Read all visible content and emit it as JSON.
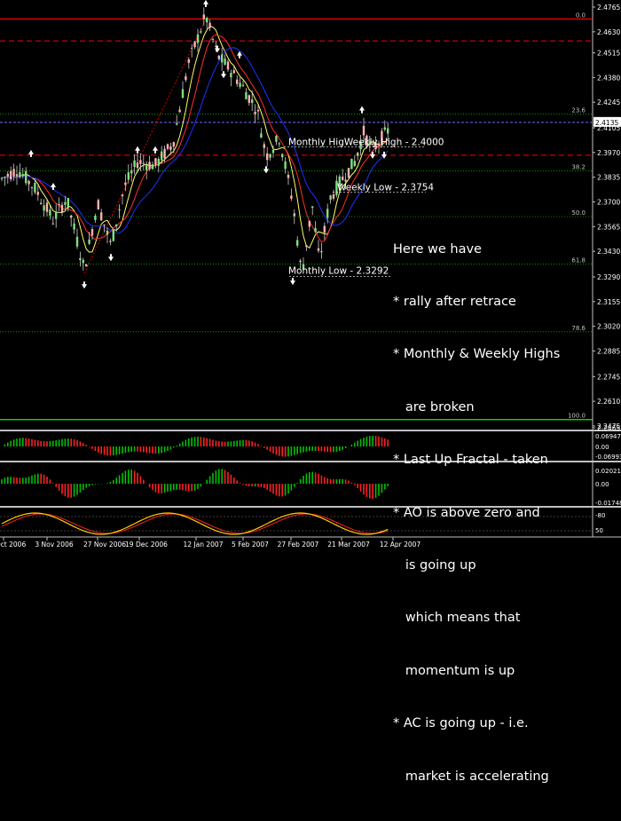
{
  "chart_data": {
    "type": "candlestick",
    "symbol_timeframe": "GBPUSD, Daily",
    "price_axis": {
      "min": 2.2465,
      "max": 2.4765,
      "ticks": [
        "2.4765",
        "2.4630",
        "2.4515",
        "2.4380",
        "2.4245",
        "2.4105",
        "2.3970",
        "2.3835",
        "2.3700",
        "2.3565",
        "2.3430",
        "2.3290",
        "2.3155",
        "2.3020",
        "2.2885",
        "2.2745",
        "2.2610",
        "2.2475",
        "2.2465"
      ],
      "current_price": "2.4135"
    },
    "date_axis": [
      "Oct 2006",
      "3 Nov 2006",
      "27 Nov 2006",
      "19 Dec 2006",
      "12 Jan 2007",
      "5 Feb 2007",
      "27 Feb 2007",
      "21 Mar 2007",
      "12 Apr 2007"
    ],
    "fibonacci_levels": [
      {
        "label": "0.0",
        "price": 2.47
      },
      {
        "label": "23.6",
        "price": 2.418
      },
      {
        "label": "38.2",
        "price": 2.387
      },
      {
        "label": "50.0",
        "price": 2.362
      },
      {
        "label": "61.8",
        "price": 2.336
      },
      {
        "label": "78.6",
        "price": 2.299
      },
      {
        "label": "100.0",
        "price": 2.251
      }
    ],
    "levels": [
      {
        "label": "Monthly HigWeekly  High  - 2.4000",
        "price": 2.4
      },
      {
        "label": "Weekly  Low  - 2.3754",
        "price": 2.3754
      },
      {
        "label": "Monthly Low  - 2.3292",
        "price": 2.3292
      }
    ],
    "ao_panel": {
      "ticks": [
        "0.06947",
        "0.00",
        "-0.06993"
      ]
    },
    "ac_panel": {
      "ticks": [
        "0.02021",
        "0.00",
        "-0.01748"
      ]
    },
    "osc_panel": {
      "ticks": [
        "-80",
        "50"
      ]
    }
  },
  "annotation": {
    "lines": [
      "Here we have",
      "* rally after retrace",
      "* Monthly & Weekly Highs",
      "   are broken",
      "* Last Up Fractal - taken",
      "* AO is above zero and",
      "   is going up",
      "   which means that",
      "   momentum is up",
      "* AC is going up - i.e.",
      "   market is accelerating"
    ]
  }
}
